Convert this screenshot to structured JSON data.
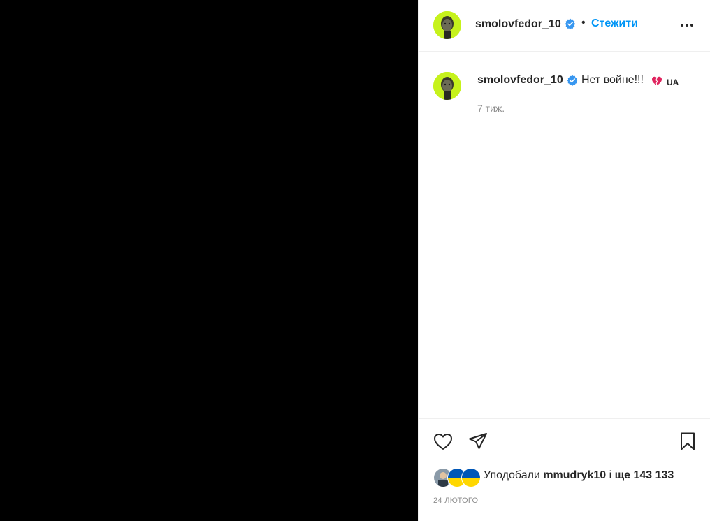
{
  "post": {
    "author": "smolovfedor_10",
    "follow_label": "Стежити",
    "separator": "•",
    "caption_text": "Нет войне!!!",
    "caption_emoji": "broken-heart-emoji",
    "caption_flag": "UA",
    "time_ago": "7 тиж.",
    "likes": {
      "prefix": "Уподобали",
      "first_user": "mmudryk10",
      "joiner": "і",
      "rest": "ще 143 133"
    },
    "date": "24 ЛЮТОГО"
  },
  "icons": {
    "verified": "verified-badge-icon",
    "more": "more-options-icon",
    "like": "heart-icon",
    "share": "paper-plane-icon",
    "save": "bookmark-icon"
  },
  "colors": {
    "accent": "#0095f6",
    "verified": "#3897f0",
    "avatar_bg": "#c6f21c",
    "muted": "#8e8e8e",
    "media_bg": "#000000",
    "ukraine_blue": "#0057b7",
    "ukraine_yellow": "#ffd700"
  }
}
